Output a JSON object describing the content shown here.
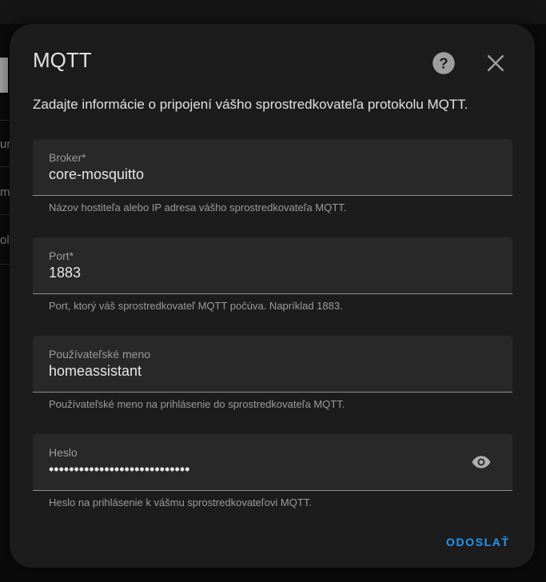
{
  "background": {
    "fragments": [
      "ur",
      "m",
      "ol"
    ]
  },
  "dialog": {
    "title": "MQTT",
    "description": "Zadajte informácie o pripojení vášho sprostredkovateľa protokolu MQTT.",
    "help_icon": "help-circle-icon",
    "close_icon": "close-icon"
  },
  "fields": {
    "broker": {
      "label": "Broker*",
      "value": "core-mosquitto",
      "helper": "Názov hostiteľa alebo IP adresa vášho sprostredkovateľa MQTT."
    },
    "port": {
      "label": "Port*",
      "value": "1883",
      "helper": "Port, ktorý váš sprostredkovateľ MQTT počúva. Napríklad 1883."
    },
    "username": {
      "label": "Používateľské meno",
      "value": "homeassistant",
      "helper": "Používateľské meno na prihlásenie do sprostredkovateľa MQTT."
    },
    "password": {
      "label": "Heslo",
      "value": "••••••••••••••••••••••••••••",
      "helper": "Heslo na prihlásenie k vášmu sprostredkovateľovi MQTT.",
      "toggle_icon": "eye-icon"
    }
  },
  "actions": {
    "submit_label": "ODOSLAŤ"
  },
  "colors": {
    "accent": "#2196f3",
    "dialog_bg": "#1c1c1c",
    "field_bg": "#282828"
  }
}
